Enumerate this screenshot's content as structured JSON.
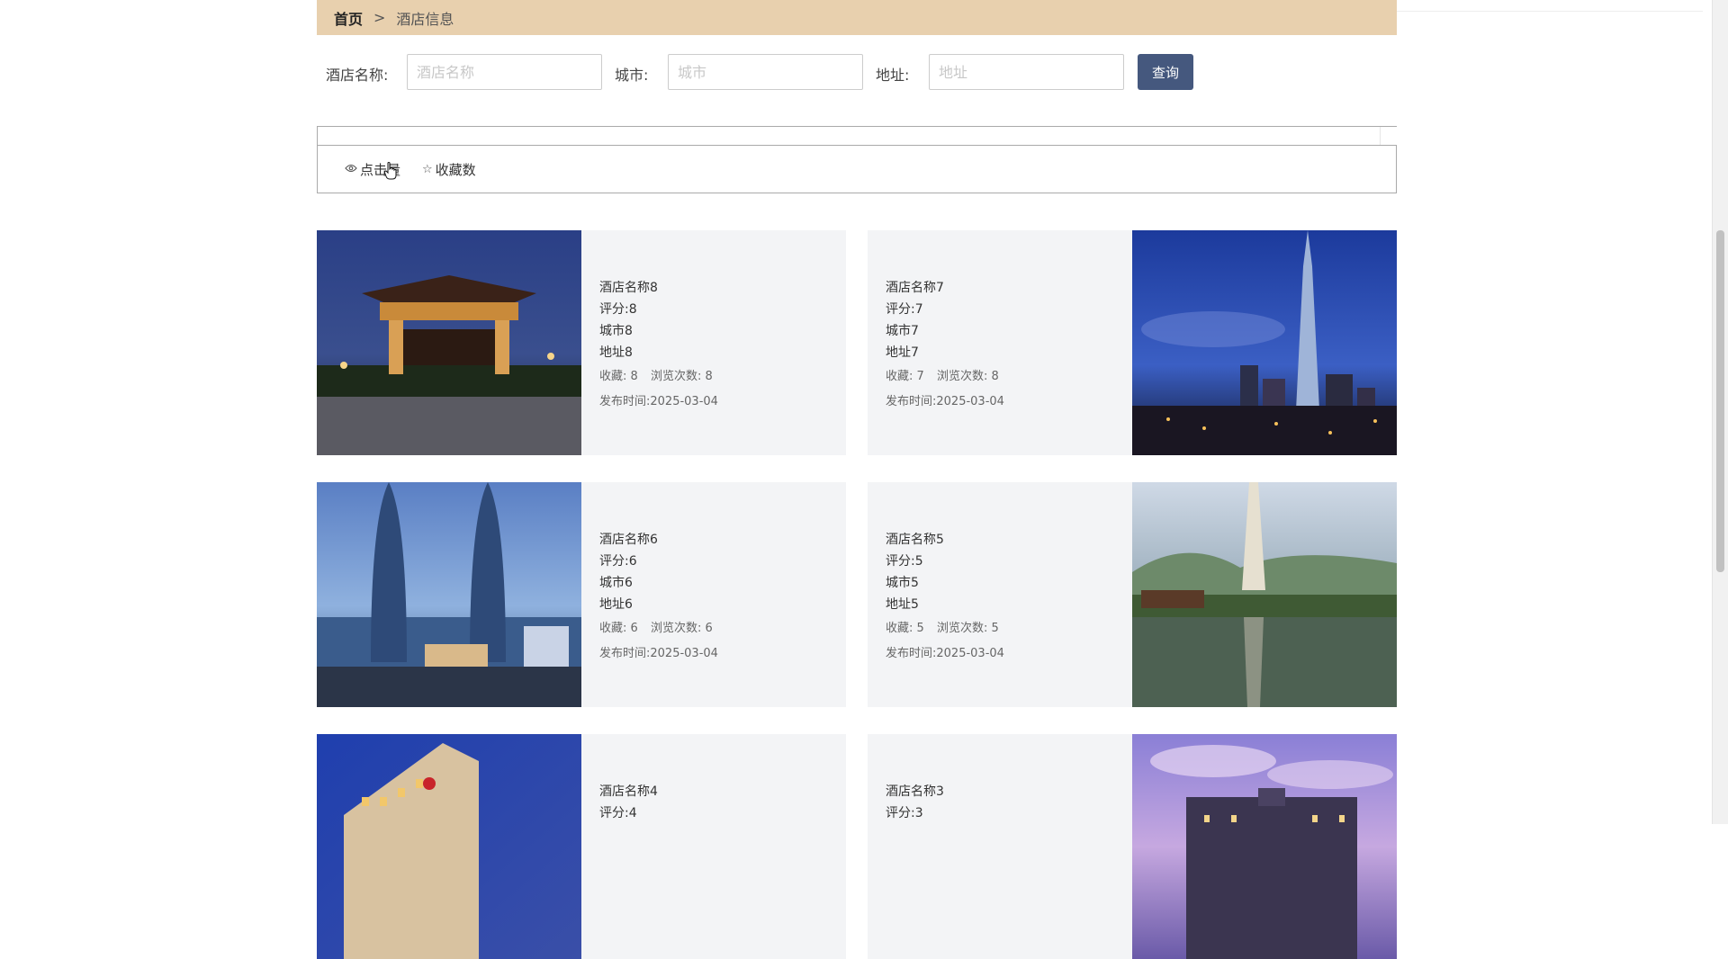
{
  "breadcrumb": {
    "home": "首页",
    "separator": ">",
    "current": "酒店信息"
  },
  "search": {
    "name_label": "酒店名称:",
    "name_placeholder": "酒店名称",
    "city_label": "城市:",
    "city_placeholder": "城市",
    "address_label": "地址:",
    "address_placeholder": "地址",
    "query_button": "查询"
  },
  "sort": {
    "clicks": {
      "label": "点击量",
      "icon": "eye-icon"
    },
    "favorites": {
      "label": "收藏数",
      "icon": "star-icon"
    }
  },
  "hotels": [
    {
      "name": "酒店名称8",
      "rating": "评分:8",
      "city": "城市8",
      "address": "地址8",
      "fav_label": "收藏:",
      "fav": "8",
      "views_label": "浏览次数:",
      "views": "8",
      "time_label": "发布时间:",
      "time": "2025-03-04"
    },
    {
      "name": "酒店名称7",
      "rating": "评分:7",
      "city": "城市7",
      "address": "地址7",
      "fav_label": "收藏:",
      "fav": "7",
      "views_label": "浏览次数:",
      "views": "8",
      "time_label": "发布时间:",
      "time": "2025-03-04"
    },
    {
      "name": "酒店名称6",
      "rating": "评分:6",
      "city": "城市6",
      "address": "地址6",
      "fav_label": "收藏:",
      "fav": "6",
      "views_label": "浏览次数:",
      "views": "6",
      "time_label": "发布时间:",
      "time": "2025-03-04"
    },
    {
      "name": "酒店名称5",
      "rating": "评分:5",
      "city": "城市5",
      "address": "地址5",
      "fav_label": "收藏:",
      "fav": "5",
      "views_label": "浏览次数:",
      "views": "5",
      "time_label": "发布时间:",
      "time": "2025-03-04"
    },
    {
      "name": "酒店名称4",
      "rating": "评分:4"
    },
    {
      "name": "酒店名称3",
      "rating": "评分:3"
    }
  ],
  "colors": {
    "breadcrumb_bg": "#e8d0ae",
    "query_button_bg": "#45587e",
    "card_bg": "#f3f4f6"
  }
}
